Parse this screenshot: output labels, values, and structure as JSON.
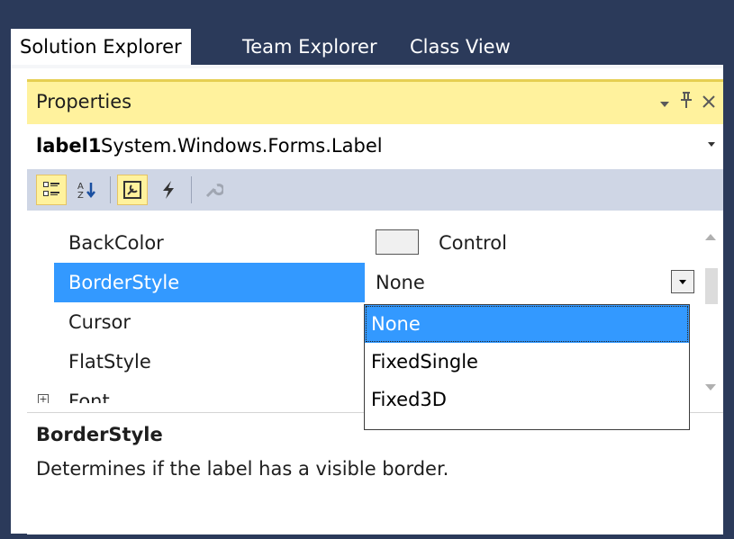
{
  "tabs": [
    {
      "label": "Solution Explorer",
      "active": true
    },
    {
      "label": "Team Explorer",
      "active": false
    },
    {
      "label": "Class View",
      "active": false
    }
  ],
  "properties_window": {
    "title": "Properties",
    "object_name": "label1",
    "object_type": "System.Windows.Forms.Label",
    "toolbar": [
      "categorized-icon",
      "alphabetical-icon",
      "properties-icon",
      "events-icon",
      "property-pages-icon"
    ],
    "rows": [
      {
        "name": "BackColor",
        "value": "Control"
      },
      {
        "name": "BorderStyle",
        "value": "None"
      },
      {
        "name": "Cursor",
        "value": ""
      },
      {
        "name": "FlatStyle",
        "value": ""
      },
      {
        "name": "Font",
        "value": ""
      }
    ],
    "dropdown_options": [
      "None",
      "FixedSingle",
      "Fixed3D"
    ],
    "description_title": "BorderStyle",
    "description_text": "Determines if the label has a visible border."
  },
  "colors": {
    "frame": "#2b3a5a",
    "title_bar": "#fff29d",
    "toolbar": "#cfd6e5",
    "selection": "#3399ff"
  }
}
